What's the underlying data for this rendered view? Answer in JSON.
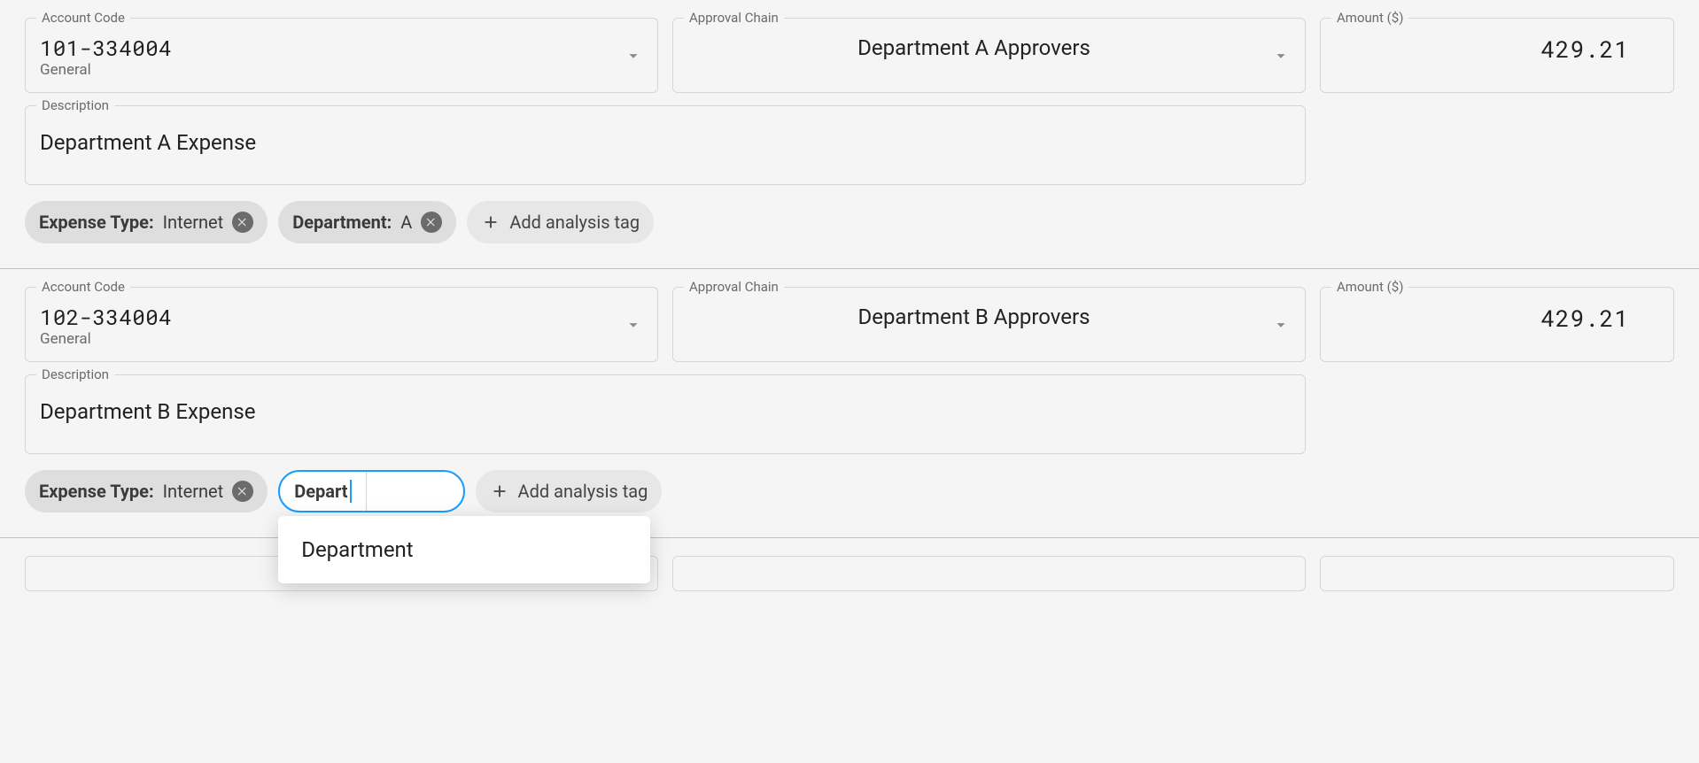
{
  "labels": {
    "account_code": "Account Code",
    "approval_chain": "Approval Chain",
    "amount": "Amount ($)",
    "description": "Description",
    "add_tag": "Add analysis tag"
  },
  "sections": [
    {
      "account": {
        "code": "101-334004",
        "subtype": "General"
      },
      "approval_chain": "Department A Approvers",
      "amount": "429.21",
      "description": "Department A Expense",
      "tags": [
        {
          "label": "Expense Type:",
          "value": "Internet"
        },
        {
          "label": "Department:",
          "value": "A"
        }
      ]
    },
    {
      "account": {
        "code": "102-334004",
        "subtype": "General"
      },
      "approval_chain": "Department B Approvers",
      "amount": "429.21",
      "description": "Department B Expense",
      "tags": [
        {
          "label": "Expense Type:",
          "value": "Internet"
        }
      ],
      "editing_tag": {
        "text": "Depart"
      },
      "autocomplete": [
        "Department"
      ]
    }
  ]
}
